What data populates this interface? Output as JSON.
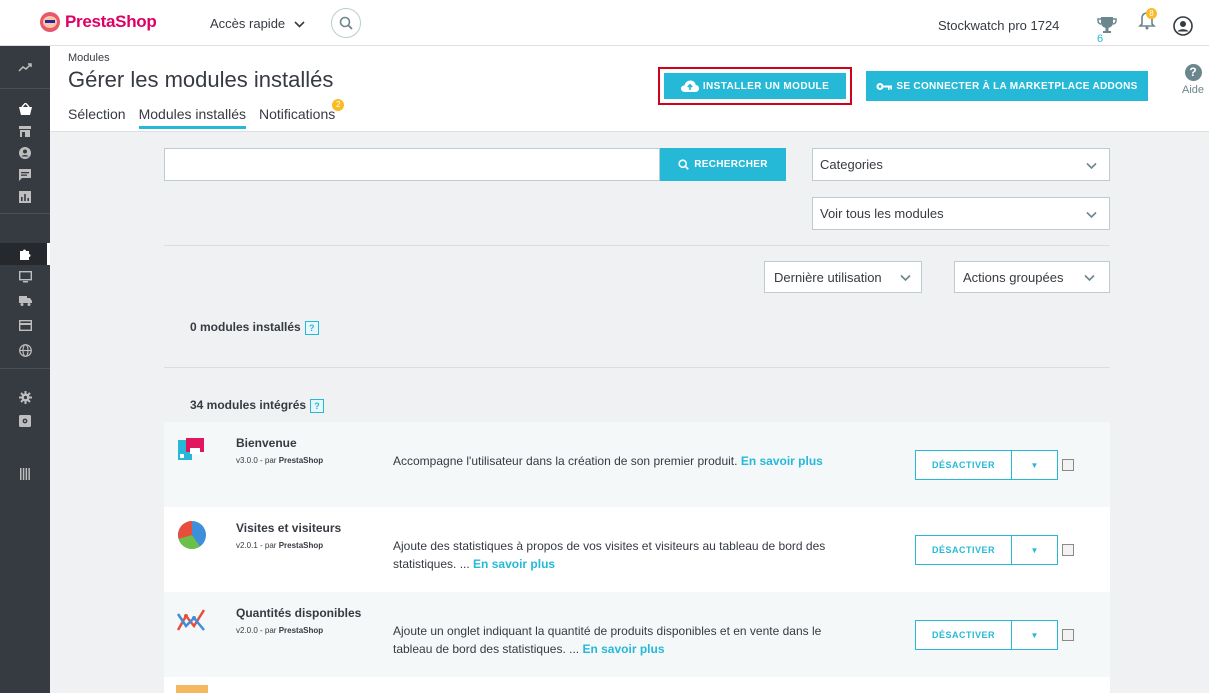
{
  "header": {
    "logo_text": "PrestaShop",
    "quick_access": "Accès rapide",
    "shop_name": "Stockwatch pro 1724",
    "trophy_count": "6",
    "notif_count": "8"
  },
  "sidebar": {
    "icons": [
      "dashboard-icon",
      "orders-icon",
      "catalog-icon",
      "customers-icon",
      "messages-icon",
      "stats-icon",
      "modules-icon",
      "design-icon",
      "shipping-icon",
      "payment-icon",
      "international-icon",
      "settings-icon",
      "advanced-icon",
      "collapse-icon"
    ]
  },
  "page": {
    "breadcrumb": "Modules",
    "title": "Gérer les modules installés",
    "tabs": [
      {
        "label": "Sélection"
      },
      {
        "label": "Modules installés"
      },
      {
        "label": "Notifications",
        "badge": "2"
      }
    ],
    "install_btn": "INSTALLER UN MODULE",
    "marketplace_btn": "SE CONNECTER À LA MARKETPLACE ADDONS",
    "help_label": "Aide"
  },
  "filters": {
    "search_placeholder": "",
    "search_btn": "RECHERCHER",
    "categories": "Categories",
    "show_all": "Voir tous les modules",
    "sort": "Dernière utilisation",
    "bulk": "Actions groupées"
  },
  "sections": {
    "installed": "0 modules installés",
    "builtin": "34 modules intégrés",
    "help_glyph": "?"
  },
  "modules": [
    {
      "name": "Bienvenue",
      "version": "v3.0.0 - par",
      "author": "PrestaShop",
      "desc": "Accompagne l'utilisateur dans la création de son premier produit.",
      "more": "En savoir plus",
      "action": "DÉSACTIVER",
      "icon": "welcome-icon"
    },
    {
      "name": "Visites et visiteurs",
      "version": "v2.0.1 - par",
      "author": "PrestaShop",
      "desc": "Ajoute des statistiques à propos de vos visites et visiteurs au tableau de bord des statistiques. ...",
      "more": "En savoir plus",
      "action": "DÉSACTIVER",
      "icon": "pie-chart-icon"
    },
    {
      "name": "Quantités disponibles",
      "version": "v2.0.0 - par",
      "author": "PrestaShop",
      "desc": "Ajoute un onglet indiquant la quantité de produits disponibles et en vente dans le tableau de bord des statistiques. ...",
      "more": "En savoir plus",
      "action": "DÉSACTIVER",
      "icon": "line-chart-icon"
    }
  ],
  "colors": {
    "accent": "#25b9d7",
    "sidebar": "#363a41",
    "highlight_border": "#d0021b",
    "badge": "#fbbb22"
  }
}
